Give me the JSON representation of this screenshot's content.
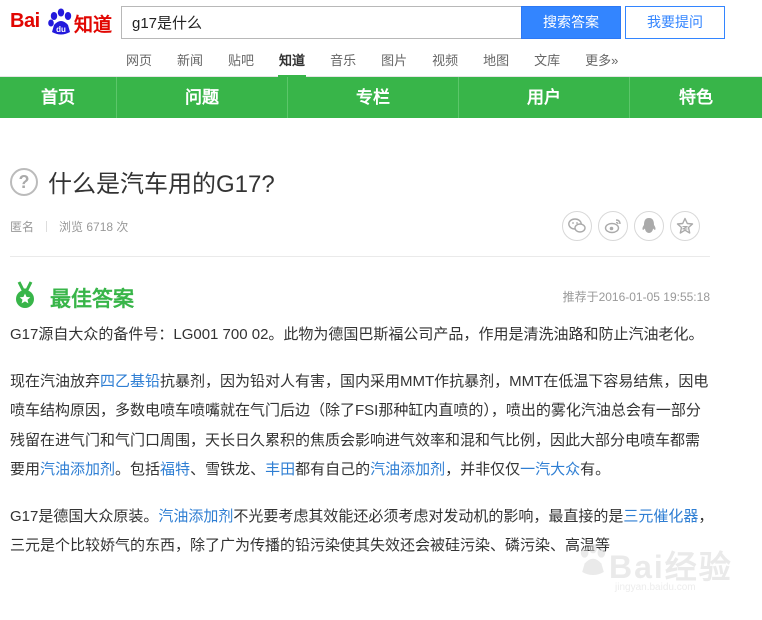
{
  "brand": {
    "logo_left": "Bai",
    "logo_mid": "du",
    "logo_right": "知道",
    "color": "#e10602"
  },
  "search": {
    "query": "g17是什么",
    "submit_label": "搜索答案",
    "ask_label": "我要提问"
  },
  "channels": {
    "items": [
      "网页",
      "新闻",
      "贴吧",
      "知道",
      "音乐",
      "图片",
      "视频",
      "地图",
      "文库",
      "更多»"
    ],
    "active": "知道"
  },
  "main_nav": {
    "color": "#38b549",
    "items": [
      "首页",
      "问题",
      "专栏",
      "用户",
      "特色"
    ]
  },
  "question": {
    "title": "什么是汽车用的G17?",
    "author": "匿名",
    "views": "浏览 6718 次"
  },
  "share_icons": [
    "wechat-icon",
    "weibo-icon",
    "qq-icon",
    "qzone-icon"
  ],
  "best_answer": {
    "heading": "最佳答案",
    "recommended": "推荐于2016-01-05 19:55:18",
    "paragraphs": [
      [
        {
          "t": "G17源自大众的备件号：LG001 700 02。此物为德国巴斯福公司产品，作用是清洗油路和防止汽油老化。"
        }
      ],
      [
        {
          "t": "现在汽油放弃"
        },
        {
          "t": "四乙基铅",
          "link": true
        },
        {
          "t": "抗暴剂，因为铅对人有害，国内采用MMT作抗暴剂，MMT在低温下容易结焦，因电喷车结构原因，多数电喷车喷嘴就在气门后边（除了FSI那种缸内直喷的），喷出的雾化汽油总会有一部分残留在进气门和气门口周围，天长日久累积的焦质会影响进气效率和混和气比例，因此大部分电喷车都需要用"
        },
        {
          "t": "汽油添加剂",
          "link": true
        },
        {
          "t": "。包括"
        },
        {
          "t": "福特",
          "link": true
        },
        {
          "t": "、雪铁龙、"
        },
        {
          "t": "丰田",
          "link": true
        },
        {
          "t": "都有自己的"
        },
        {
          "t": "汽油添加剂",
          "link": true
        },
        {
          "t": "，并非仅仅"
        },
        {
          "t": "一汽大众",
          "link": true
        },
        {
          "t": "有。"
        }
      ],
      [
        {
          "t": "G17是德国大众原装。"
        },
        {
          "t": "汽油添加剂",
          "link": true
        },
        {
          "t": "不光要考虑其效能还必须考虑对发动机的影响，最直接的是"
        },
        {
          "t": "三元催化器",
          "link": true
        },
        {
          "t": "，三元是个比较娇气的东西，除了广为传播的铅污染使其失效还会被硅污染、磷污染、高温等"
        }
      ]
    ]
  },
  "watermark": {
    "text": "Bai经验",
    "sub": "jingyan.baidu.com"
  },
  "colors": {
    "accent_green": "#38b549",
    "link_blue": "#2e7ed3",
    "search_blue": "#3385ff"
  }
}
